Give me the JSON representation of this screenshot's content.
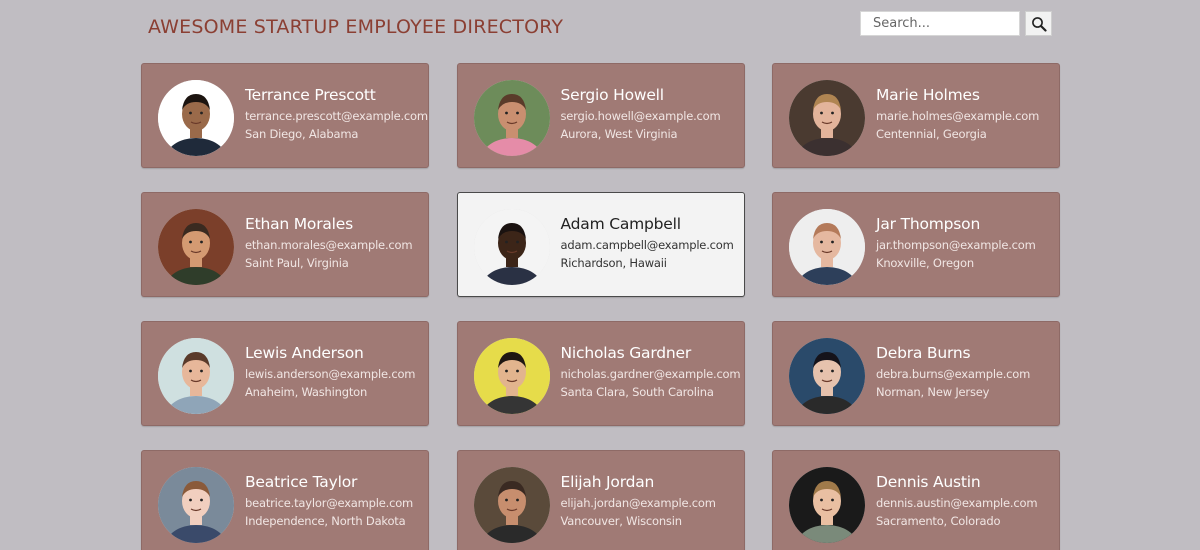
{
  "header": {
    "title": "AWESOME STARTUP EMPLOYEE DIRECTORY",
    "search_placeholder": "Search...",
    "search_icon": "magnifier-icon"
  },
  "colors": {
    "page_background": "#c0bdc2",
    "title": "#8b3f33",
    "card_background": "#a07a75",
    "card_selected_background": "#f3f3f3"
  },
  "employees": [
    {
      "name": "Terrance Prescott",
      "email": "terrance.prescott@example.com",
      "location": "San Diego, Alabama",
      "selected": false
    },
    {
      "name": "Sergio Howell",
      "email": "sergio.howell@example.com",
      "location": "Aurora, West Virginia",
      "selected": false
    },
    {
      "name": "Marie Holmes",
      "email": "marie.holmes@example.com",
      "location": "Centennial, Georgia",
      "selected": false
    },
    {
      "name": "Ethan Morales",
      "email": "ethan.morales@example.com",
      "location": "Saint Paul, Virginia",
      "selected": false
    },
    {
      "name": "Adam Campbell",
      "email": "adam.campbell@example.com",
      "location": "Richardson, Hawaii",
      "selected": true
    },
    {
      "name": "Jar Thompson",
      "email": "jar.thompson@example.com",
      "location": "Knoxville, Oregon",
      "selected": false
    },
    {
      "name": "Lewis Anderson",
      "email": "lewis.anderson@example.com",
      "location": "Anaheim, Washington",
      "selected": false
    },
    {
      "name": "Nicholas Gardner",
      "email": "nicholas.gardner@example.com",
      "location": "Santa Clara, South Carolina",
      "selected": false
    },
    {
      "name": "Debra Burns",
      "email": "debra.burns@example.com",
      "location": "Norman, New Jersey",
      "selected": false
    },
    {
      "name": "Beatrice Taylor",
      "email": "beatrice.taylor@example.com",
      "location": "Independence, North Dakota",
      "selected": false
    },
    {
      "name": "Elijah Jordan",
      "email": "elijah.jordan@example.com",
      "location": "Vancouver, Wisconsin",
      "selected": false
    },
    {
      "name": "Dennis Austin",
      "email": "dennis.austin@example.com",
      "location": "Sacramento, Colorado",
      "selected": false
    }
  ]
}
